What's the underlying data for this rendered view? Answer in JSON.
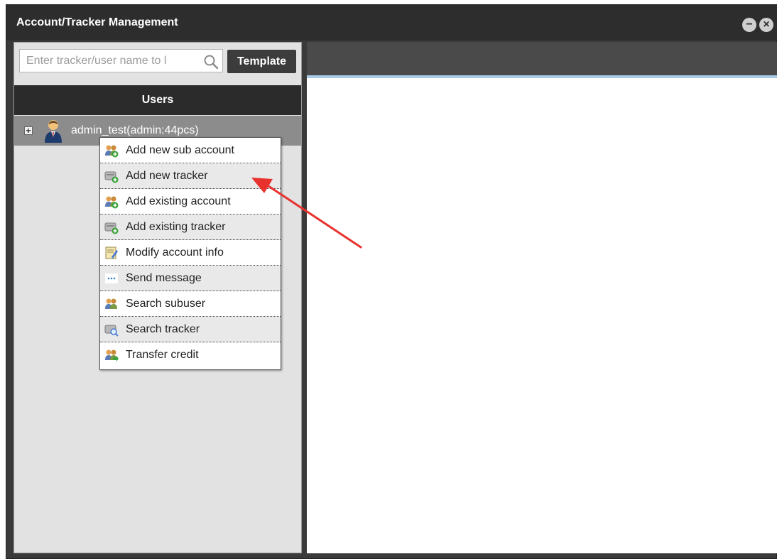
{
  "window": {
    "title": "Account/Tracker Management",
    "minimize_icon": "minus-circle-icon",
    "close_icon": "close-circle-icon"
  },
  "left_panel": {
    "search": {
      "placeholder": "Enter tracker/user name to l",
      "icon": "search-icon"
    },
    "template_button": "Template",
    "users_header": "Users",
    "tree": {
      "expand_icon": "plus-box-icon",
      "user_icon": "user-avatar-icon",
      "label": "admin_test(admin:44pcs)"
    }
  },
  "context_menu": {
    "items": [
      {
        "label": "Add new sub account",
        "icon": "users-add-icon"
      },
      {
        "label": "Add new tracker",
        "icon": "tracker-add-icon"
      },
      {
        "label": "Add existing account",
        "icon": "users-add-icon"
      },
      {
        "label": "Add existing tracker",
        "icon": "tracker-add-icon"
      },
      {
        "label": "Modify account info",
        "icon": "edit-note-icon"
      },
      {
        "label": "Send message",
        "icon": "message-dots-icon"
      },
      {
        "label": "Search subuser",
        "icon": "users-search-icon"
      },
      {
        "label": "Search tracker",
        "icon": "tracker-search-icon"
      },
      {
        "label": "Transfer credit",
        "icon": "users-transfer-icon"
      }
    ]
  },
  "annotation": {
    "arrow_color": "#e8322e",
    "points_to": "Add new tracker"
  },
  "colors": {
    "titlebar": "#2d2d2d",
    "panel_bg": "#e2e2e2",
    "header_dark": "#2b2b2b",
    "tree_row": "#8c8c8c",
    "accent_blue": "#a9cbe8"
  }
}
